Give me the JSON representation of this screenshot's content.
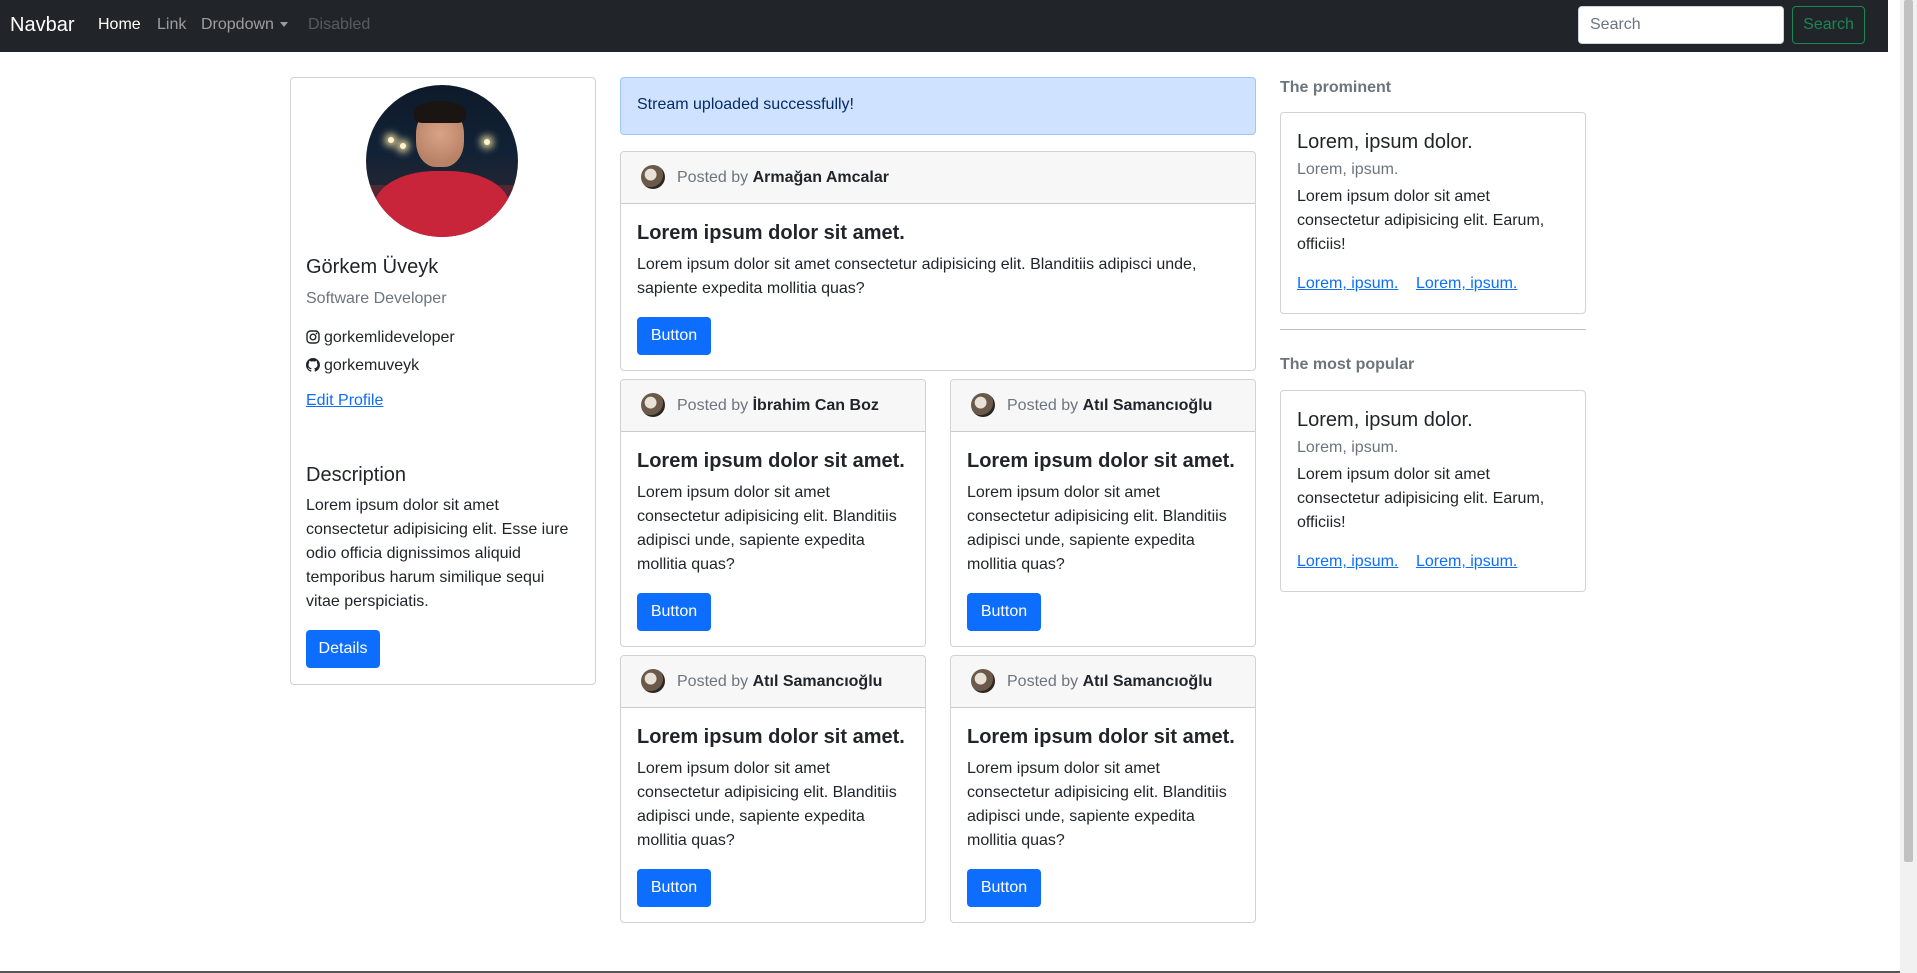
{
  "navbar": {
    "brand": "Navbar",
    "links": [
      {
        "label": "Home"
      },
      {
        "label": "Link"
      },
      {
        "label": "Dropdown"
      },
      {
        "label": "Disabled"
      }
    ],
    "search_placeholder": "Search",
    "search_button": "Search"
  },
  "profile": {
    "name": "Görkem Üveyk",
    "role": "Software Developer",
    "instagram": "gorkemlideveloper",
    "github": "gorkemuveyk",
    "edit_link": "Edit Profile",
    "description_title": "Description",
    "description_text": "Lorem ipsum dolor sit amet consectetur adipisicing elit. Esse iure odio officia dignissimos aliquid temporibus harum similique sequi vitae perspiciatis.",
    "details_button": "Details"
  },
  "alert": {
    "message": "Stream uploaded successfully!"
  },
  "posts": [
    {
      "posted_by_label": "Posted by",
      "author": "Armağan Amcalar",
      "title": "Lorem ipsum dolor sit amet.",
      "text": "Lorem ipsum dolor sit amet consectetur adipisicing elit. Blanditiis adipisci unde, sapiente expedita mollitia quas?",
      "button": "Button"
    },
    {
      "posted_by_label": "Posted by",
      "author": "İbrahim Can Boz",
      "title": "Lorem ipsum dolor sit amet.",
      "text": "Lorem ipsum dolor sit amet consectetur adipisicing elit. Blanditiis adipisci unde, sapiente expedita mollitia quas?",
      "button": "Button"
    },
    {
      "posted_by_label": "Posted by",
      "author": "Atıl Samancıoğlu",
      "title": "Lorem ipsum dolor sit amet.",
      "text": "Lorem ipsum dolor sit amet consectetur adipisicing elit. Blanditiis adipisci unde, sapiente expedita mollitia quas?",
      "button": "Button"
    },
    {
      "posted_by_label": "Posted by",
      "author": "Atıl Samancıoğlu",
      "title": "Lorem ipsum dolor sit amet.",
      "text": "Lorem ipsum dolor sit amet consectetur adipisicing elit. Blanditiis adipisci unde, sapiente expedita mollitia quas?",
      "button": "Button"
    },
    {
      "posted_by_label": "Posted by",
      "author": "Atıl Samancıoğlu",
      "title": "Lorem ipsum dolor sit amet.",
      "text": "Lorem ipsum dolor sit amet consectetur adipisicing elit. Blanditiis adipisci unde, sapiente expedita mollitia quas?",
      "button": "Button"
    }
  ],
  "sidebar": {
    "prominent_heading": "The prominent",
    "popular_heading": "The most popular",
    "cards": [
      {
        "title": "Lorem, ipsum dolor.",
        "subtitle": "Lorem, ipsum.",
        "text": "Lorem ipsum dolor sit amet consectetur adipisicing elit. Earum, officiis!",
        "link1": "Lorem, ipsum.",
        "link2": "Lorem, ipsum."
      },
      {
        "title": "Lorem, ipsum dolor.",
        "subtitle": "Lorem, ipsum.",
        "text": "Lorem ipsum dolor sit amet consectetur adipisicing elit. Earum, officiis!",
        "link1": "Lorem, ipsum.",
        "link2": "Lorem, ipsum."
      }
    ]
  },
  "colors": {
    "navbar_bg": "#212529",
    "primary": "#0d6efd",
    "success": "#198754",
    "alert_bg": "#cfe2ff"
  }
}
